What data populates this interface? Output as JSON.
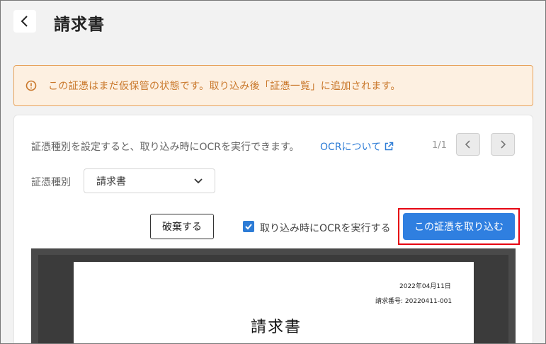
{
  "header": {
    "title": "請求書"
  },
  "alert": {
    "text": "この証憑はまだ仮保管の状態です。取り込み後「証憑一覧」に追加されます。"
  },
  "ocr": {
    "info": "証憑種別を設定すると、取り込み時にOCRを実行できます。",
    "link_label": "OCRについて"
  },
  "pager": {
    "text": "1/1"
  },
  "type": {
    "label": "証憑種別",
    "selected": "請求書"
  },
  "actions": {
    "discard_label": "破棄する",
    "ocr_checkbox_label": "取り込み時にOCRを実行する",
    "ocr_checked": true,
    "import_label": "この証憑を取り込む"
  },
  "preview": {
    "date": "2022年04月11日",
    "number": "請求番号: 20220411-001",
    "title": "請求書"
  },
  "colors": {
    "accent": "#2f7fe0",
    "alert_text": "#c9772a",
    "alert_border": "#e7a35c",
    "highlight": "#e60012"
  }
}
